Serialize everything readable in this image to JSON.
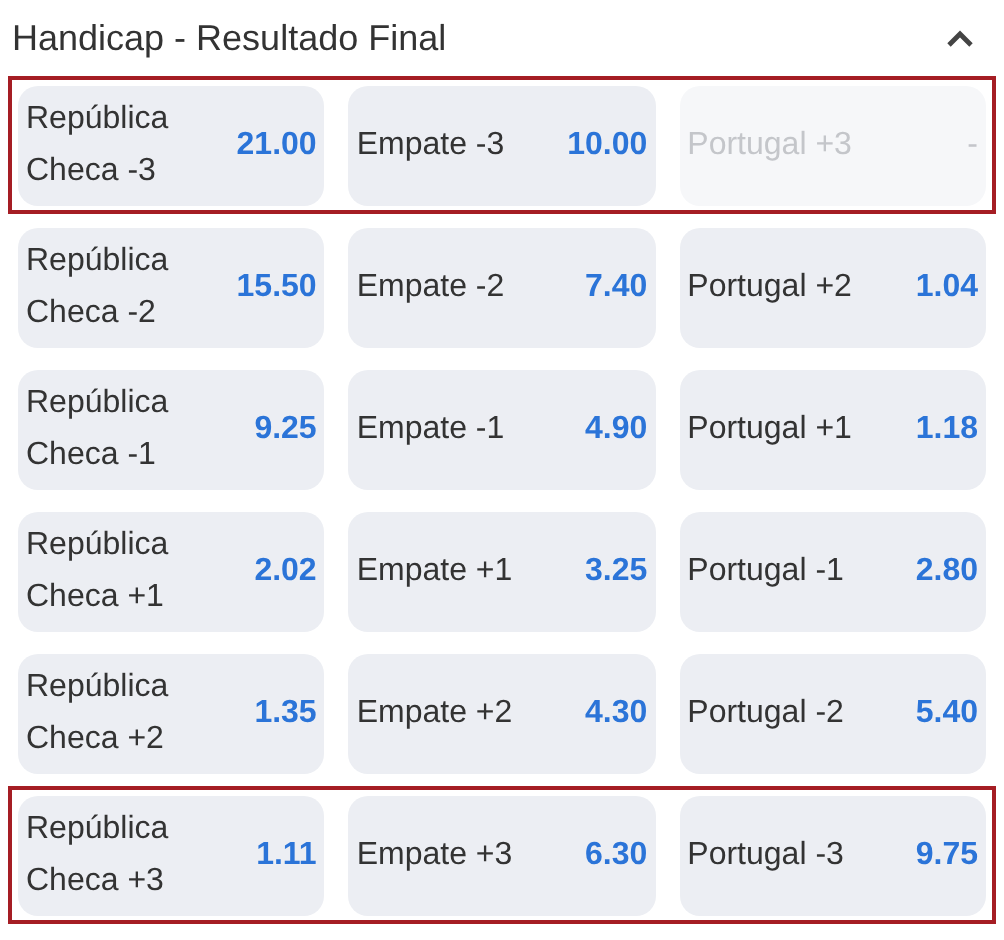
{
  "title": "Handicap - Resultado Final",
  "expanded": true,
  "rows": [
    {
      "highlighted": true,
      "cells": [
        {
          "label": "República Checa -3",
          "odds": "21.00",
          "disabled": false
        },
        {
          "label": "Empate -3",
          "odds": "10.00",
          "disabled": false
        },
        {
          "label": "Portugal +3",
          "odds": "-",
          "disabled": true
        }
      ]
    },
    {
      "highlighted": false,
      "cells": [
        {
          "label": "República Checa -2",
          "odds": "15.50",
          "disabled": false
        },
        {
          "label": "Empate -2",
          "odds": "7.40",
          "disabled": false
        },
        {
          "label": "Portugal +2",
          "odds": "1.04",
          "disabled": false
        }
      ]
    },
    {
      "highlighted": false,
      "cells": [
        {
          "label": "República Checa -1",
          "odds": "9.25",
          "disabled": false
        },
        {
          "label": "Empate -1",
          "odds": "4.90",
          "disabled": false
        },
        {
          "label": "Portugal +1",
          "odds": "1.18",
          "disabled": false
        }
      ]
    },
    {
      "highlighted": false,
      "cells": [
        {
          "label": "República Checa +1",
          "odds": "2.02",
          "disabled": false
        },
        {
          "label": "Empate +1",
          "odds": "3.25",
          "disabled": false
        },
        {
          "label": "Portugal -1",
          "odds": "2.80",
          "disabled": false
        }
      ]
    },
    {
      "highlighted": false,
      "cells": [
        {
          "label": "República Checa +2",
          "odds": "1.35",
          "disabled": false
        },
        {
          "label": "Empate +2",
          "odds": "4.30",
          "disabled": false
        },
        {
          "label": "Portugal -2",
          "odds": "5.40",
          "disabled": false
        }
      ]
    },
    {
      "highlighted": true,
      "cells": [
        {
          "label": "República Checa +3",
          "odds": "1.11",
          "disabled": false
        },
        {
          "label": "Empate +3",
          "odds": "6.30",
          "disabled": false
        },
        {
          "label": "Portugal -3",
          "odds": "9.75",
          "disabled": false
        }
      ]
    }
  ]
}
